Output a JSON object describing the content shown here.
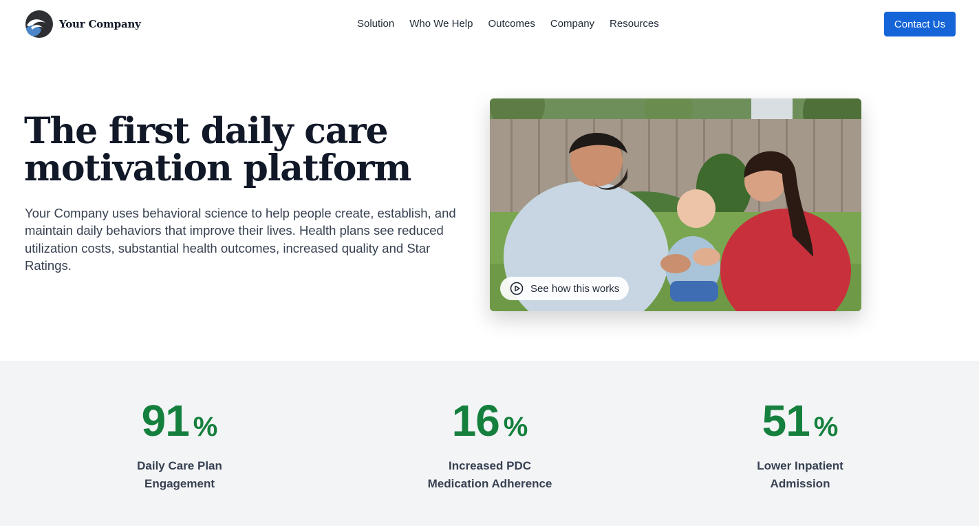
{
  "brand": {
    "name": "Your Company",
    "logo_icon": "swoosh-logo-icon",
    "accent_color": "#1565d8"
  },
  "nav": {
    "items": [
      {
        "label": "Solution"
      },
      {
        "label": "Who We Help"
      },
      {
        "label": "Outcomes"
      },
      {
        "label": "Company"
      },
      {
        "label": "Resources"
      }
    ],
    "cta_label": "Contact Us"
  },
  "hero": {
    "title_line1": "The first daily care",
    "title_line2": "motivation platform",
    "description": "Your Company uses behavioral science to help people create, establish, and maintain daily behaviors that improve their lives. Health plans see reduced utilization costs, substantial health outcomes, increased quality and Star Ratings.",
    "video_label": "See how this works",
    "video_icon": "play-circle-icon"
  },
  "stats": {
    "color": "#15803d",
    "items": [
      {
        "value": "91",
        "unit": "%",
        "label_line1": "Daily Care Plan",
        "label_line2": "Engagement"
      },
      {
        "value": "16",
        "unit": "%",
        "label_line1": "Increased PDC",
        "label_line2": "Medication Adherence"
      },
      {
        "value": "51",
        "unit": "%",
        "label_line1": "Lower Inpatient",
        "label_line2": "Admission"
      }
    ]
  }
}
